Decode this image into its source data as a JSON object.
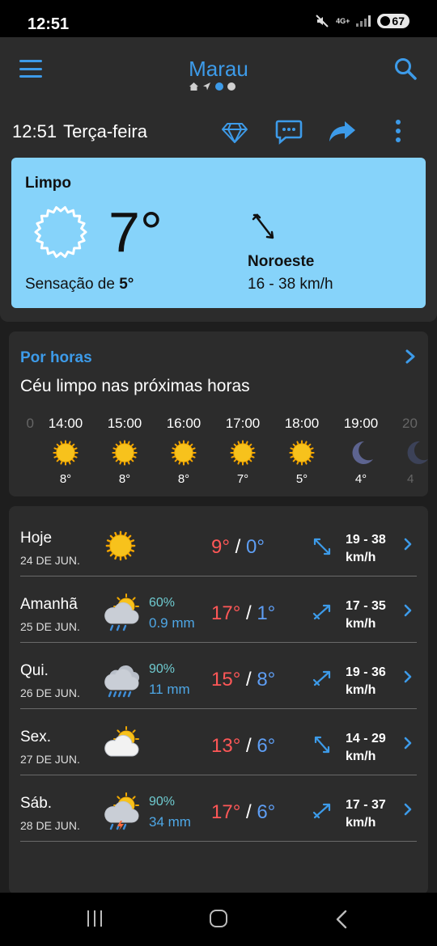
{
  "status_bar": {
    "time": "12:51",
    "network": "4G+",
    "battery": "67"
  },
  "header": {
    "city": "Marau"
  },
  "info_line": {
    "time": "12:51",
    "weekday": "Terça-feira"
  },
  "current": {
    "condition": "Limpo",
    "temperature": "7°",
    "feels_like_label": "Sensação de",
    "feels_like_value": "5°",
    "wind_direction": "Noroeste",
    "wind_speed": "16 - 38 km/h"
  },
  "hourly": {
    "title": "Por horas",
    "summary": "Céu limpo nas próximas horas",
    "partial_left": {
      "time": "0"
    },
    "items": [
      {
        "time": "14:00",
        "icon": "sun-icon",
        "temp": "8°"
      },
      {
        "time": "15:00",
        "icon": "sun-icon",
        "temp": "8°"
      },
      {
        "time": "16:00",
        "icon": "sun-icon",
        "temp": "8°"
      },
      {
        "time": "17:00",
        "icon": "sun-icon",
        "temp": "7°"
      },
      {
        "time": "18:00",
        "icon": "sun-icon",
        "temp": "5°"
      },
      {
        "time": "19:00",
        "icon": "moon-icon",
        "temp": "4°"
      }
    ],
    "partial_right": {
      "time": "20",
      "temp": "4"
    }
  },
  "daily": [
    {
      "name": "Hoje",
      "date": "24 DE JUN.",
      "icon": "sun-icon",
      "prob": "",
      "rain": "",
      "max": "9°",
      "min": "0°",
      "wind": "19 - 38",
      "wind_unit": "km/h",
      "wind_icon": "wind-nw-arrow-icon"
    },
    {
      "name": "Amanhã",
      "date": "25 DE JUN.",
      "icon": "rain-cloud-icon",
      "prob": "60%",
      "rain": "0.9 mm",
      "max": "17°",
      "min": "1°",
      "wind": "17 - 35",
      "wind_unit": "km/h",
      "wind_icon": "wind-ne-arrow-icon"
    },
    {
      "name": "Qui.",
      "date": "26 DE JUN.",
      "icon": "heavy-rain-cloud-icon",
      "prob": "90%",
      "rain": "11 mm",
      "max": "15°",
      "min": "8°",
      "wind": "19 - 36",
      "wind_unit": "km/h",
      "wind_icon": "wind-ne-arrow-icon"
    },
    {
      "name": "Sex.",
      "date": "27 DE JUN.",
      "icon": "partly-cloudy-icon",
      "prob": "",
      "rain": "",
      "max": "13°",
      "min": "6°",
      "wind": "14 - 29",
      "wind_unit": "km/h",
      "wind_icon": "wind-nw-se-arrow-icon"
    },
    {
      "name": "Sáb.",
      "date": "28 DE JUN.",
      "icon": "thunderstorm-icon",
      "prob": "90%",
      "rain": "34 mm",
      "max": "17°",
      "min": "6°",
      "wind": "17 - 37",
      "wind_unit": "km/h",
      "wind_icon": "wind-ne-arrow-icon"
    }
  ],
  "colors": {
    "accent": "#3d9be9",
    "card_current": "#86d3fa",
    "max_temp": "#ff5757",
    "min_temp": "#5e9ef4",
    "precip_prob": "#6fcbd0",
    "sun": "#f5b400"
  }
}
